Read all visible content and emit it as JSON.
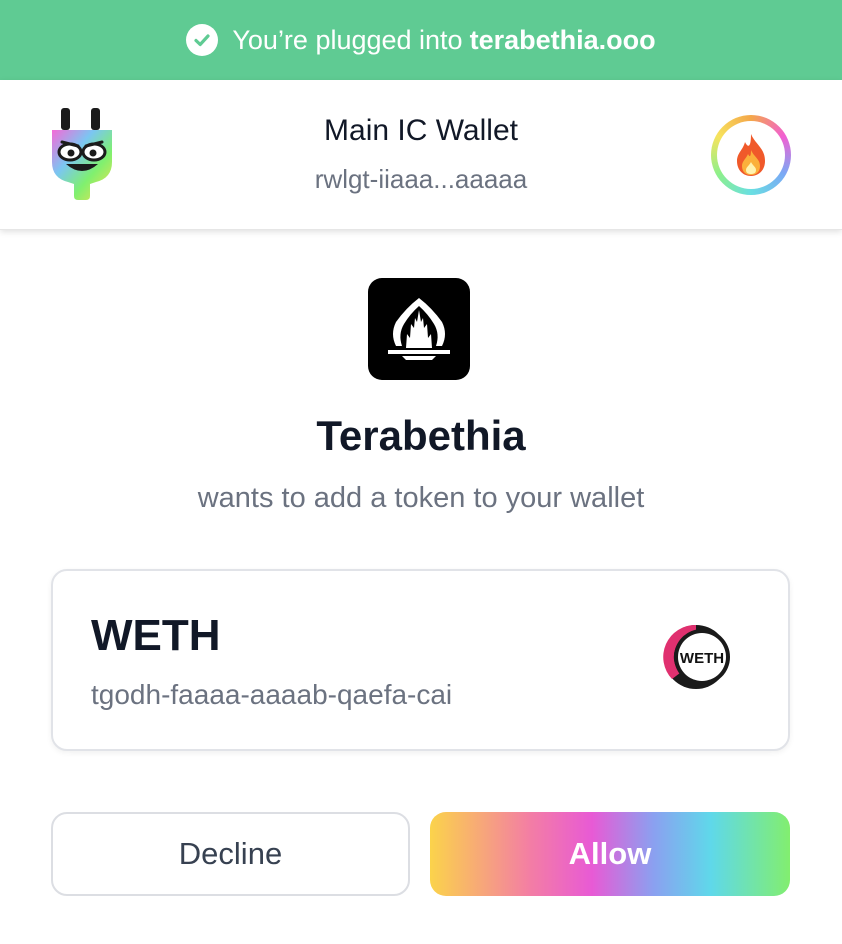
{
  "banner": {
    "prefix": "You’re plugged into",
    "domain": "terabethia.ooo",
    "icon": "check-circle-icon",
    "color": "#5fcb93"
  },
  "header": {
    "wallet_name": "Main IC Wallet",
    "wallet_id": "rwlgt-iiaaa...aaaaa",
    "logo_icon": "plug-logo-icon",
    "avatar_icon": "fire-emoji-avatar"
  },
  "app": {
    "name": "Terabethia",
    "request": "wants to add a token to your wallet",
    "logo_icon": "terabethia-castle-logo"
  },
  "token": {
    "symbol": "WETH",
    "canister_id": "tgodh-faaaa-aaaab-qaefa-cai",
    "icon": "weth-token-icon",
    "icon_text": "WETH"
  },
  "actions": {
    "decline_label": "Decline",
    "allow_label": "Allow"
  }
}
